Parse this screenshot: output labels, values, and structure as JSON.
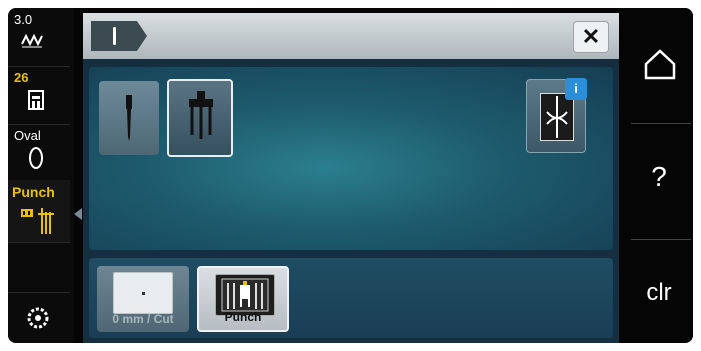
{
  "sidebar": {
    "stitch_width": {
      "value": "3.0",
      "icon": "stitch-width-icon"
    },
    "presser_foot": {
      "value": "26",
      "icon": "presser-foot-icon"
    },
    "hoop": {
      "value": "Oval",
      "icon": "oval-hoop-icon"
    },
    "technique": {
      "label": "Punch",
      "icon": "punch-needle-icon"
    },
    "bottom": {
      "icon": "bobbin-icon"
    }
  },
  "topbar": {
    "tab_icon": "needle-icon",
    "close_label": "✕"
  },
  "needles": {
    "single": {
      "icon": "single-needle-icon",
      "selected": false
    },
    "twin": {
      "icon": "triple-needle-icon",
      "selected": true
    },
    "info": {
      "icon": "needle-threading-info-icon",
      "badge": "i"
    }
  },
  "options": {
    "cut": {
      "label": "0 mm / Cut",
      "selected": false
    },
    "punch": {
      "label": "Punch",
      "selected": true
    }
  },
  "rightbar": {
    "home_icon": "home-icon",
    "help_label": "?",
    "clear_label": "clr"
  },
  "colors": {
    "accent": "#e9c100",
    "panel": "#1d5a6d",
    "info": "#2a8fd8"
  }
}
